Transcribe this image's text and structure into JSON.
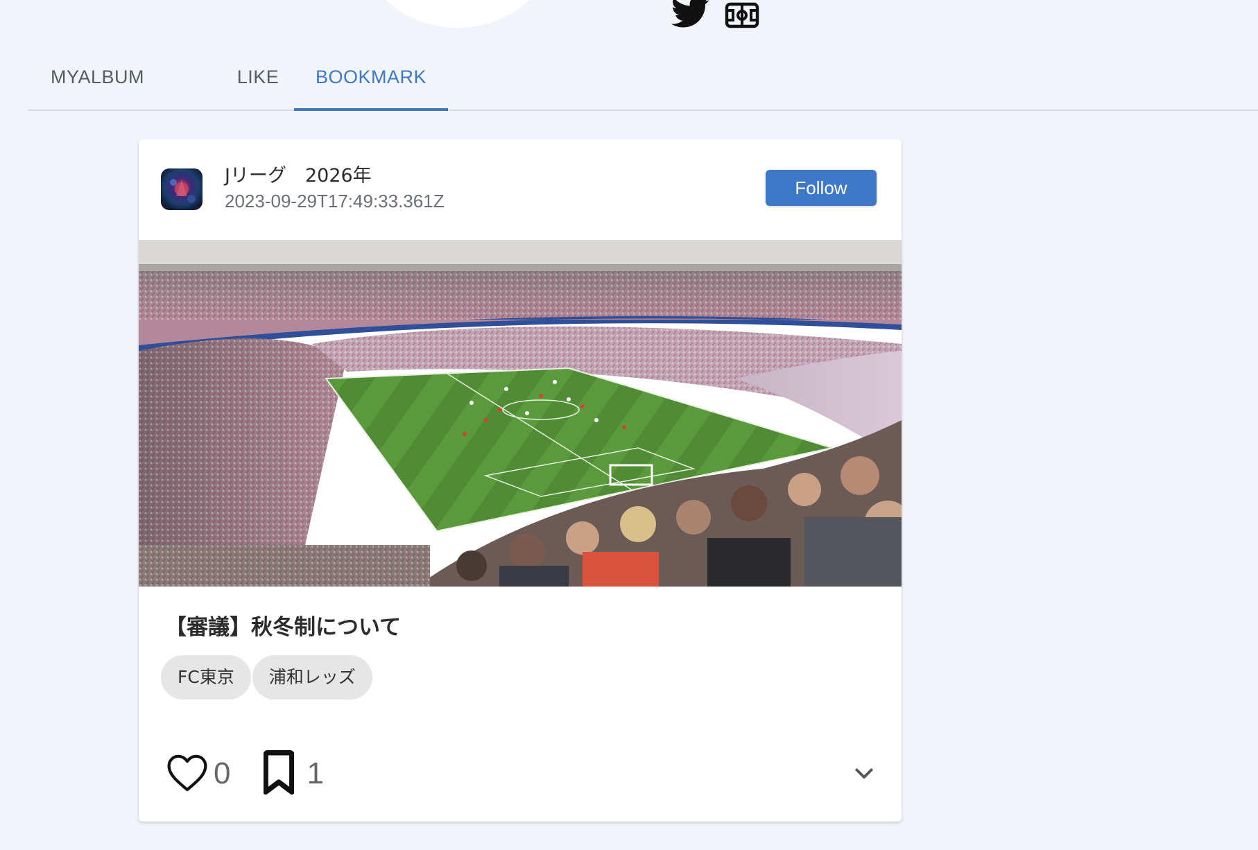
{
  "header": {
    "social_icons": [
      "twitter-icon",
      "stadium-icon"
    ]
  },
  "tabs": [
    {
      "label": "MYALBUM",
      "active": false
    },
    {
      "label": "LIKE",
      "active": false
    },
    {
      "label": "BOOKMARK",
      "active": true
    }
  ],
  "post": {
    "author": "Jリーグ　2026年",
    "timestamp": "2023-09-29T17:49:33.361Z",
    "follow_label": "Follow",
    "image_subject": "football stadium crowd",
    "title": "【審議】秋冬制について",
    "tags": [
      "FC東京",
      "浦和レッズ"
    ],
    "like_count": "0",
    "bookmark_count": "1"
  },
  "colors": {
    "accent": "#3f78c6",
    "background": "#f1f4f9",
    "card": "#ffffff",
    "tag_bg": "#e6e6e6"
  }
}
